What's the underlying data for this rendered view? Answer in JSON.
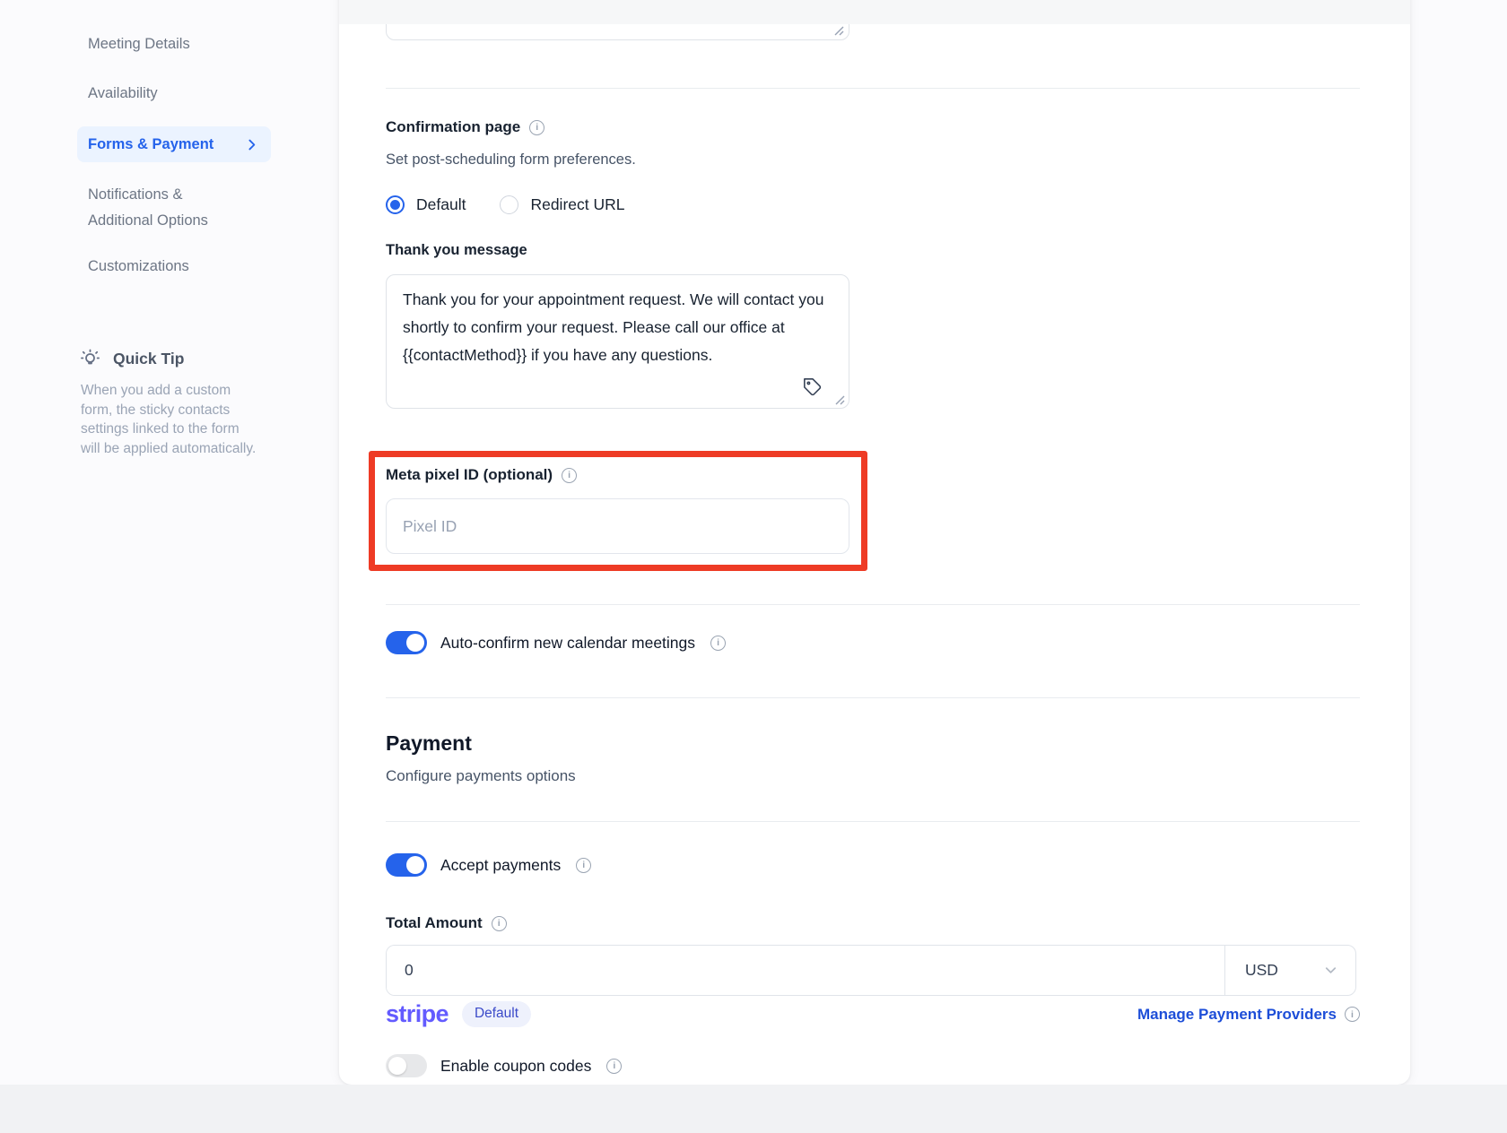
{
  "sidebar": {
    "items": [
      {
        "label": "Meeting Details",
        "active": false
      },
      {
        "label": "Availability",
        "active": false
      },
      {
        "label": "Forms & Payment",
        "active": true
      },
      {
        "label": "Notifications & Additional Options",
        "active": false
      },
      {
        "label": "Customizations",
        "active": false
      }
    ],
    "quick_tip": {
      "title": "Quick Tip",
      "body": "When you add a custom form, the sticky contacts settings linked to the form will be applied automatically."
    }
  },
  "main": {
    "confirmation": {
      "title": "Confirmation page",
      "subtitle": "Set post-scheduling form preferences.",
      "options": [
        {
          "label": "Default",
          "selected": true
        },
        {
          "label": "Redirect URL",
          "selected": false
        }
      ],
      "thank_you_label": "Thank you message",
      "thank_you_message": "Thank you for your appointment request. We will contact you shortly to confirm your request. Please call our office at {{contactMethod}} if you have any questions."
    },
    "meta_pixel": {
      "label": "Meta pixel ID (optional)",
      "placeholder": "Pixel ID"
    },
    "auto_confirm": {
      "label": "Auto-confirm new calendar meetings",
      "enabled": true
    },
    "payment": {
      "title": "Payment",
      "subtitle": "Configure payments options",
      "accept_label": "Accept payments",
      "accept_enabled": true,
      "total_amount_label": "Total Amount",
      "total_amount_value": "0",
      "currency": "USD",
      "provider_name": "stripe",
      "provider_badge": "Default",
      "manage_link": "Manage Payment Providers",
      "coupon_label": "Enable coupon codes",
      "coupon_enabled": false
    }
  },
  "icons": {
    "info_glyph": "i"
  },
  "colors": {
    "accent": "#2563eb",
    "annotation_highlight": "#ee3b25",
    "stripe_brand": "#635bff",
    "link": "#1d4ed8",
    "active_nav_bg": "#ebf3ff"
  }
}
